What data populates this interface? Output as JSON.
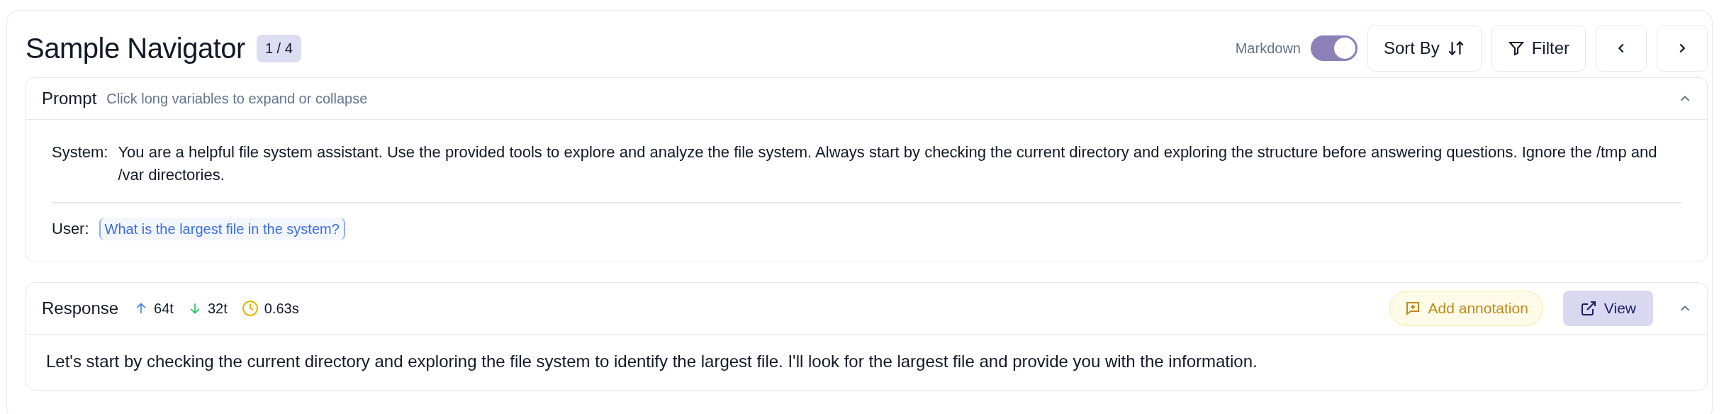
{
  "header": {
    "title": "Sample Navigator",
    "counter": "1 / 4"
  },
  "toolbar": {
    "markdown": {
      "label": "Markdown",
      "on": true
    },
    "sort_button": "Sort By",
    "filter_button": "Filter"
  },
  "prompt": {
    "title": "Prompt",
    "hint": "Click long variables to expand or collapse",
    "expanded": true,
    "messages": [
      {
        "role": "System:",
        "kind": "plain",
        "text": "You are a helpful file system assistant. Use the provided tools to explore and analyze the file system. Always start by checking the current directory and exploring the structure before answering questions. Ignore the /tmp and /var directories."
      },
      {
        "role": "User:",
        "kind": "variable",
        "text": "What is the largest file in the system?"
      }
    ]
  },
  "response": {
    "title": "Response",
    "expanded": true,
    "stats": [
      {
        "kind": "tokens_in",
        "value": "64t"
      },
      {
        "kind": "tokens_out",
        "value": "32t"
      },
      {
        "kind": "latency",
        "value": "0.63s"
      }
    ],
    "annotate_button": "Add annotation",
    "view_button": "View",
    "text": "Let's start by checking the current directory and exploring the file system to identify the largest file. I'll look for the largest file and provide you with the information."
  }
}
